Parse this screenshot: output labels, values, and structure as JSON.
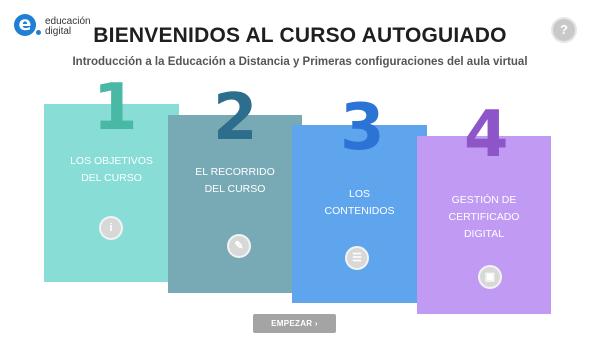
{
  "logo": {
    "mark": "e",
    "text": "educación\ndigital"
  },
  "help": {
    "icon": "?"
  },
  "header": {
    "title": "BIENVENIDOS AL CURSO AUTOGUIADO",
    "subtitle": "Introducción a la Educación a Distancia y Primeras configuraciones del aula virtual"
  },
  "cards": [
    {
      "number": "1",
      "label": "LOS OBJETIVOS\nDEL CURSO",
      "icon": "info-icon",
      "glyph": "i",
      "color": "#88ddd6"
    },
    {
      "number": "2",
      "label": "EL RECORRIDO\nDEL CURSO",
      "icon": "pin-icon",
      "glyph": "✎",
      "color": "#78aab6"
    },
    {
      "number": "3",
      "label": "LOS\nCONTENIDOS",
      "icon": "list-icon",
      "glyph": "☰",
      "color": "#5fa5ee"
    },
    {
      "number": "4",
      "label": "GESTIÓN DE\nCERTIFICADO\nDIGITAL",
      "icon": "image-icon",
      "glyph": "▣",
      "color": "#c19af3"
    }
  ],
  "start_button": {
    "label": "EMPEZAR ›"
  }
}
